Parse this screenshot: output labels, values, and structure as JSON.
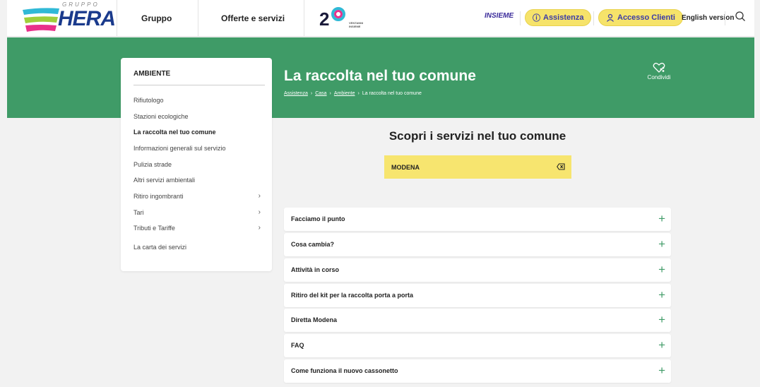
{
  "header": {
    "logo_top": "GRUPPO",
    "logo_main": "HERA",
    "nav": [
      "Gruppo",
      "Offerte e servizi"
    ],
    "anniversary": {
      "number": "2",
      "small_text": "VENTANNI INSIEME"
    },
    "insieme": "INSIEME",
    "assistenza_label": "Assistenza",
    "accesso_label": "Accesso Clienti",
    "english_label": "English version"
  },
  "hero": {
    "title": "La raccolta nel tuo comune",
    "breadcrumb": [
      "Assistenza",
      "Casa",
      "Ambiente",
      "La raccolta nel tuo comune"
    ],
    "share_label": "Condividi"
  },
  "sidebar": {
    "title": "AMBIENTE",
    "items": [
      {
        "label": "Rifiutologo",
        "chevron": false,
        "active": false
      },
      {
        "label": "Stazioni ecologiche",
        "chevron": false,
        "active": false
      },
      {
        "label": "La raccolta nel tuo comune",
        "chevron": false,
        "active": true
      },
      {
        "label": "Informazioni generali sul servizio",
        "chevron": false,
        "active": false
      },
      {
        "label": "Pulizia strade",
        "chevron": false,
        "active": false
      },
      {
        "label": "Altri servizi ambientali",
        "chevron": false,
        "active": false
      },
      {
        "label": "Ritiro ingombranti",
        "chevron": true,
        "active": false
      },
      {
        "label": "Tari",
        "chevron": true,
        "active": false
      },
      {
        "label": "Tributi e Tariffe",
        "chevron": true,
        "active": false
      },
      {
        "label": "La carta dei servizi",
        "chevron": false,
        "active": false
      }
    ]
  },
  "main": {
    "heading": "Scopri i servizi nel tuo comune",
    "comune_value": "MODENA",
    "accordion": [
      "Facciamo il punto",
      "Cosa cambia?",
      "Attività in corso",
      "Ritiro del kit per la raccolta porta a porta",
      "Diretta Modena",
      "FAQ",
      "Come funziona il nuovo cassonetto"
    ]
  },
  "colors": {
    "brand_green": "#3f9b67",
    "highlight_yellow": "#f7e56f",
    "brand_blue": "#1a3a8c"
  }
}
